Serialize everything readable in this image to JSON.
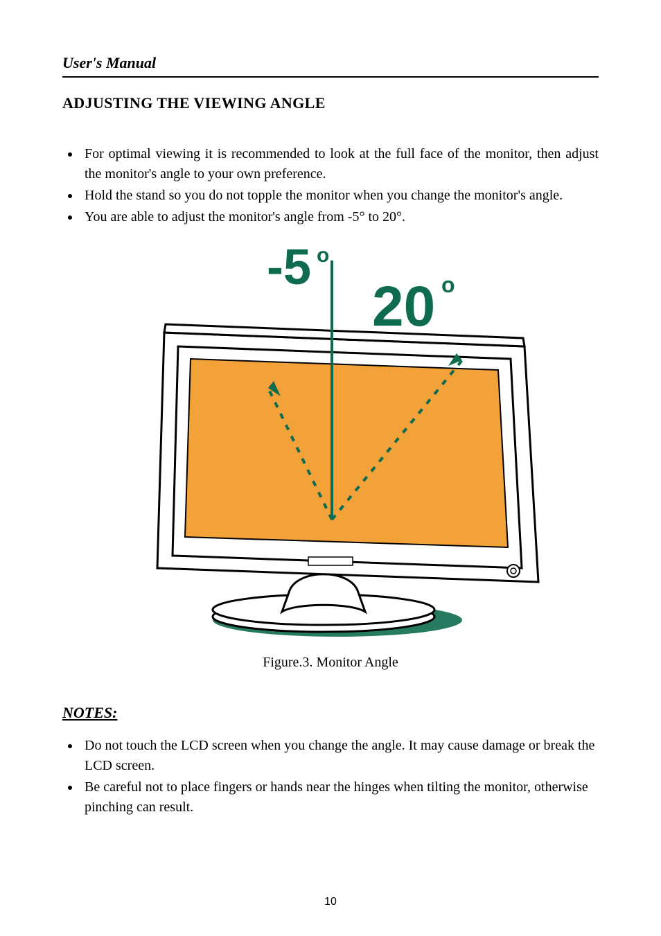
{
  "header": {
    "running_title": "User's Manual"
  },
  "section": {
    "title": "ADJUSTING THE VIEWING ANGLE"
  },
  "bullets": [
    "For optimal viewing it is recommended to look at the full face of the monitor, then adjust the monitor's angle to your own preference.",
    "Hold the stand so you do not topple the monitor when you change the monitor's angle.",
    "You are able to adjust the monitor's angle from -5° to 20°."
  ],
  "figure": {
    "label_neg5": "-5",
    "label_neg5_deg": "o",
    "label_20": "20",
    "label_20_deg": "o",
    "caption_prefix": "Figure.3.",
    "caption_text": " Monitor Angle"
  },
  "notes": {
    "heading": "NOTES:",
    "items": [
      "Do not touch the LCD screen when you change the angle. It may cause damage or break the LCD screen.",
      "Be careful not to place fingers or hands near the hinges when tilting the monitor, otherwise pinching can result."
    ]
  },
  "page_number": "10"
}
